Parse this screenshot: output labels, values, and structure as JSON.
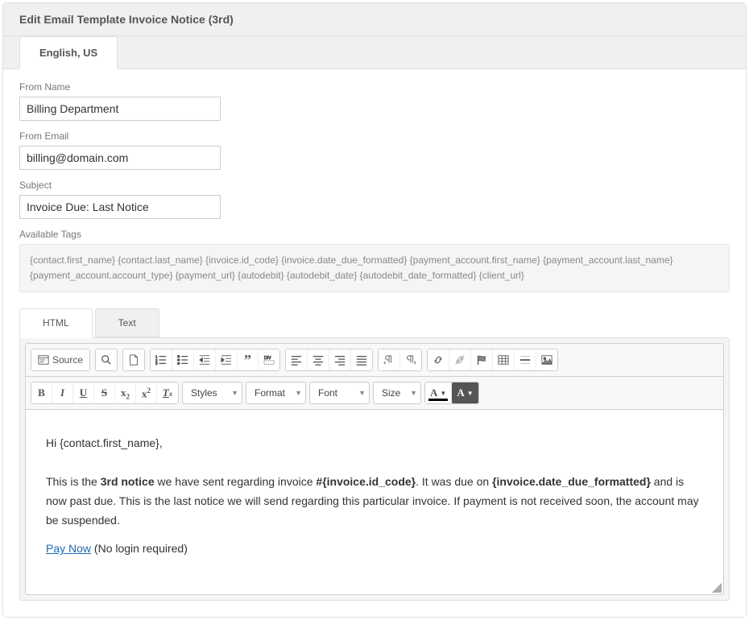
{
  "header": {
    "title": "Edit Email Template Invoice Notice (3rd)"
  },
  "lang_tabs": {
    "active": "English, US"
  },
  "form": {
    "from_name": {
      "label": "From Name",
      "value": "Billing Department"
    },
    "from_email": {
      "label": "From Email",
      "value": "billing@domain.com"
    },
    "subject": {
      "label": "Subject",
      "value": "Invoice Due: Last Notice"
    },
    "available_tags": {
      "label": "Available Tags",
      "value": "{contact.first_name} {contact.last_name} {invoice.id_code} {invoice.date_due_formatted} {payment_account.first_name} {payment_account.last_name} {payment_account.account_type} {payment_url} {autodebit} {autodebit_date} {autodebit_date_formatted} {client_url}"
    }
  },
  "editor_tabs": {
    "html": "HTML",
    "text": "Text",
    "active": "html"
  },
  "toolbar": {
    "source": "Source",
    "combos": {
      "styles": "Styles",
      "format": "Format",
      "font": "Font",
      "size": "Size"
    }
  },
  "body": {
    "greeting_prefix": "Hi ",
    "greeting_token": "{contact.first_name}",
    "greeting_suffix": ",",
    "p2a": "This is the ",
    "p2_bold1": "3rd notice",
    "p2b": " we have sent regarding invoice ",
    "p2_bold2": "#{invoice.id_code}",
    "p2c": ". It was due on ",
    "p2_bold3": "{invoice.date_due_formatted}",
    "p2d": " and is now past due. This is the last notice we will send regarding this particular invoice. If payment is not received soon, the account may be suspended.",
    "pay_link": "Pay Now",
    "pay_suffix": " (No login required)"
  }
}
